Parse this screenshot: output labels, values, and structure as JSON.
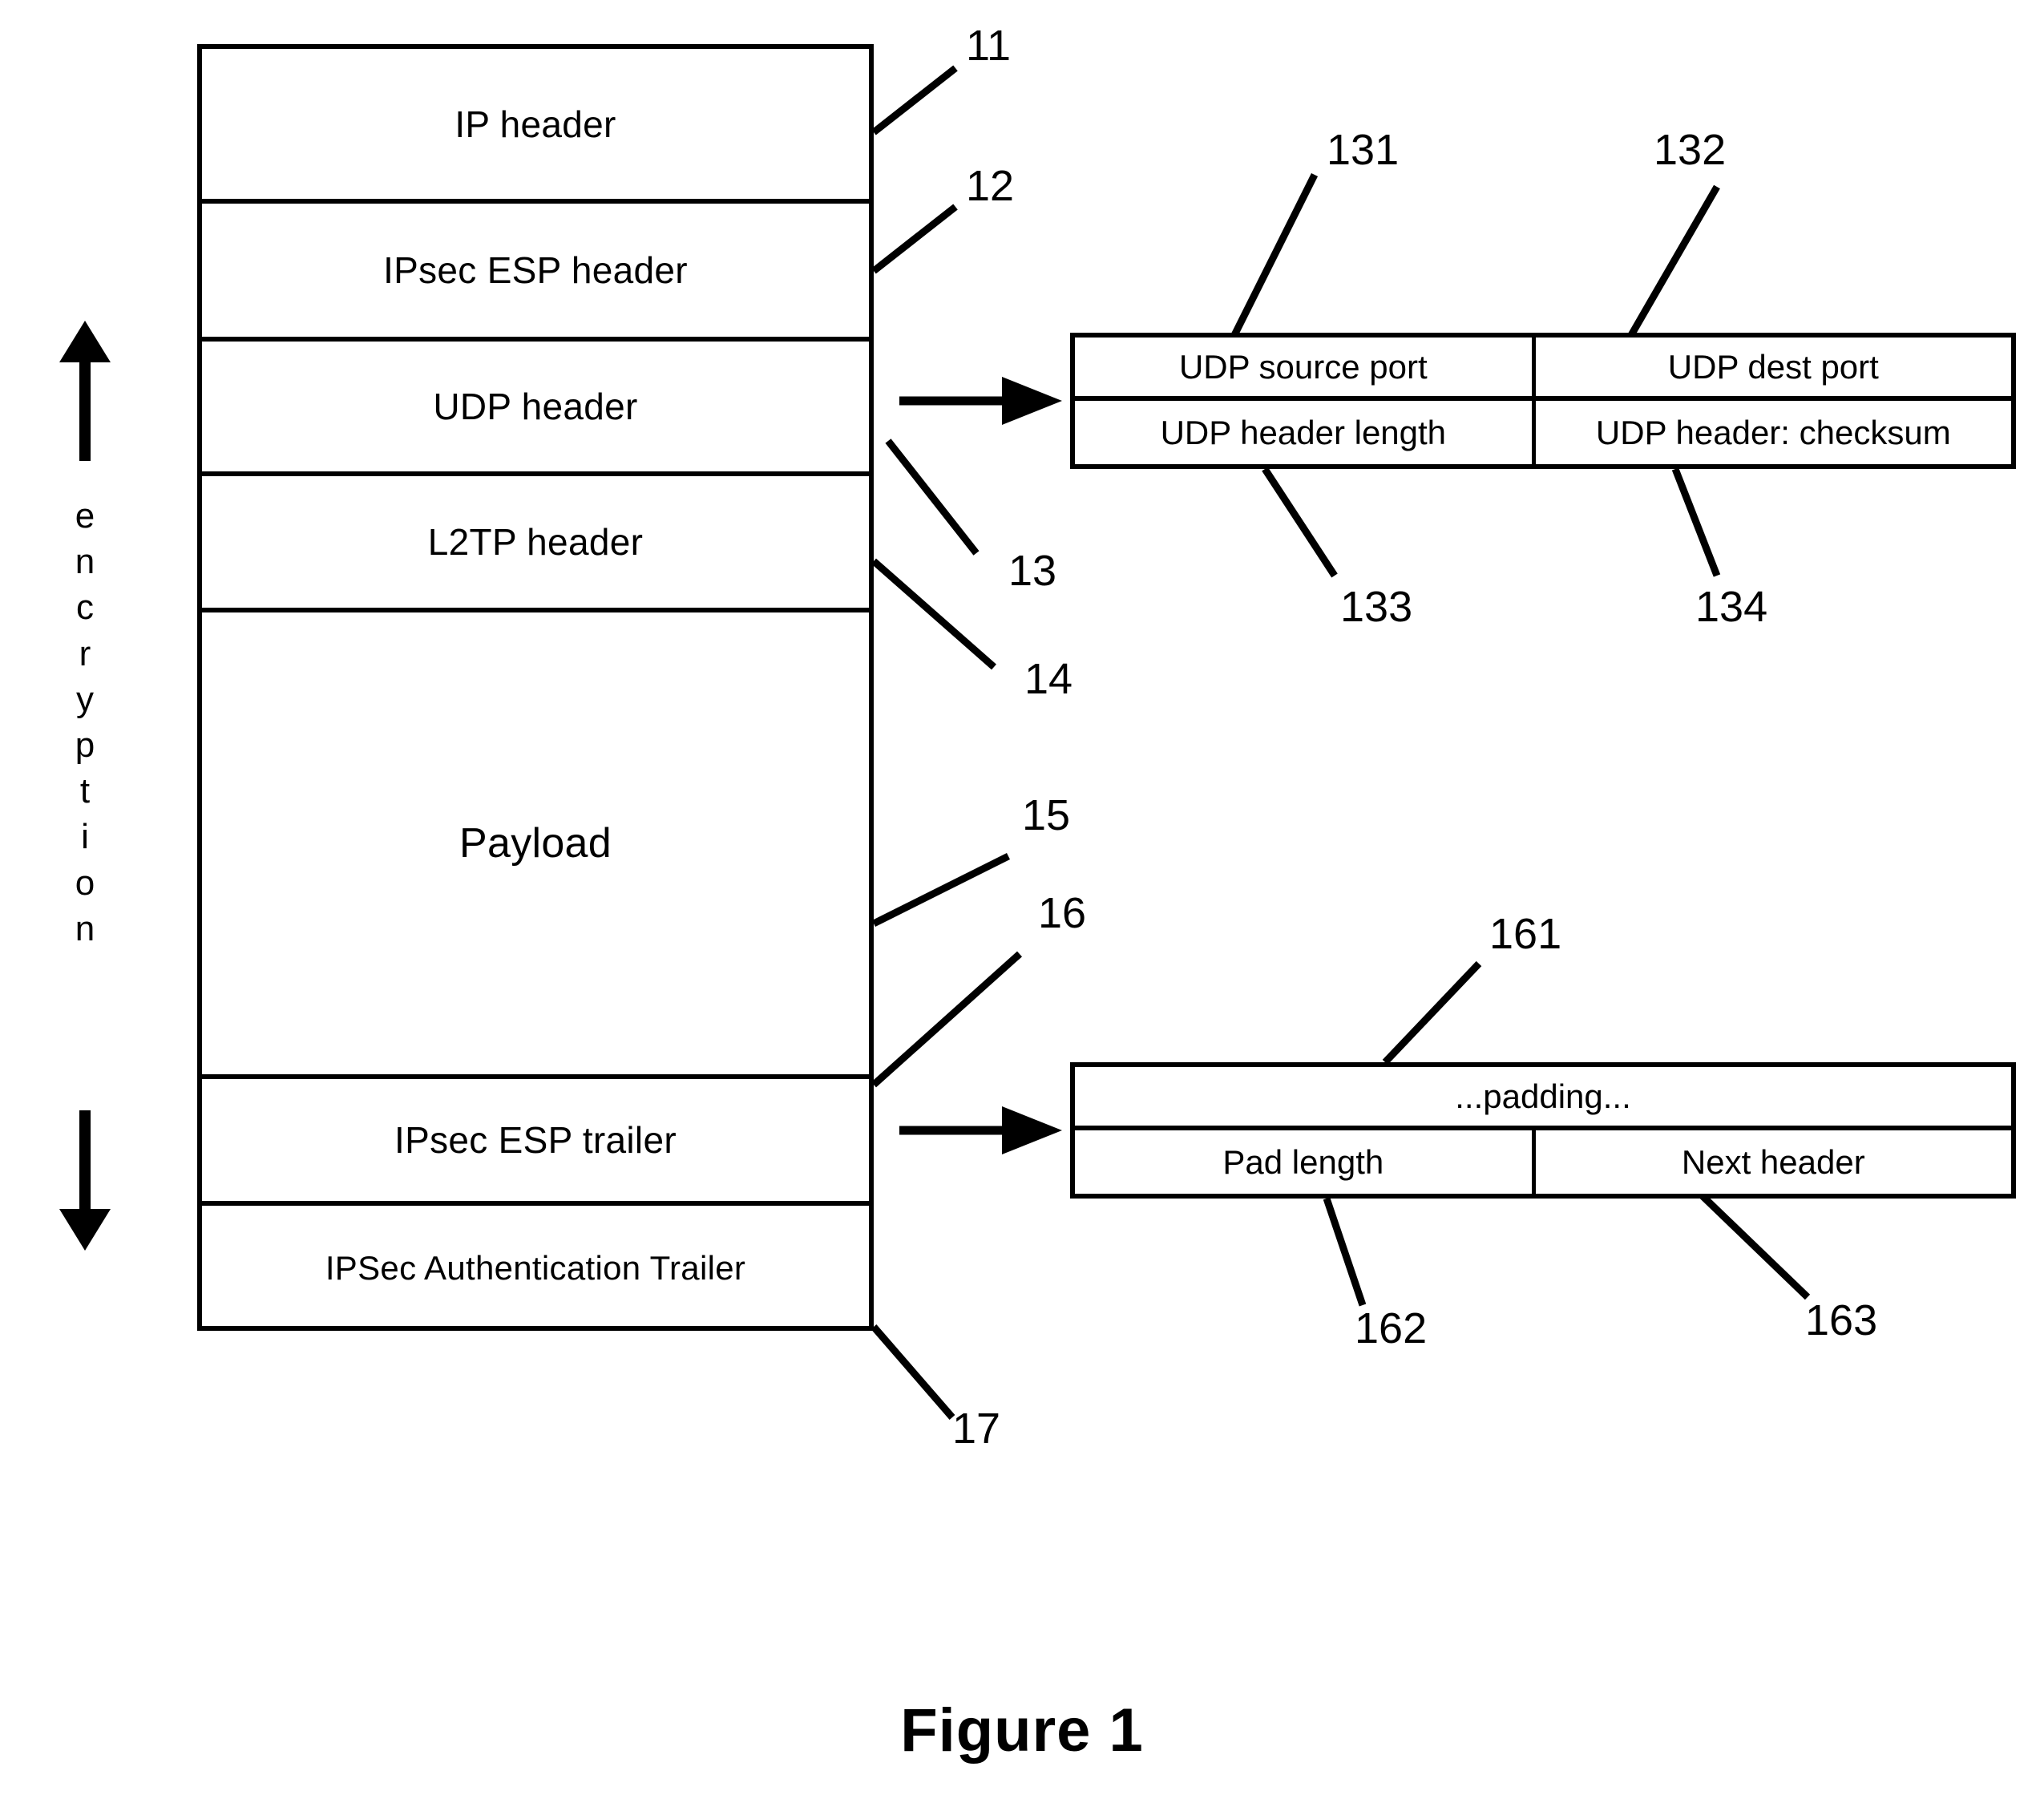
{
  "figure": {
    "caption": "Figure 1",
    "encryption_label_letters": [
      "e",
      "n",
      "c",
      "r",
      "y",
      "p",
      "t",
      "i",
      "o",
      "n"
    ],
    "encryption_label_text": "encryption"
  },
  "packet_stack": {
    "rows": [
      {
        "label": "IP header",
        "ref": "11"
      },
      {
        "label": "IPsec ESP header",
        "ref": "12"
      },
      {
        "label": "UDP header",
        "ref": "13"
      },
      {
        "label": "L2TP header",
        "ref": "14"
      },
      {
        "label": "Payload",
        "ref": "15"
      },
      {
        "label": "IPsec ESP trailer",
        "ref": "16"
      },
      {
        "label": "IPSec Authentication Trailer",
        "ref": "17"
      }
    ]
  },
  "udp_detail": {
    "cells": [
      {
        "label": "UDP source port",
        "ref": "131"
      },
      {
        "label": "UDP dest port",
        "ref": "132"
      },
      {
        "label": "UDP header length",
        "ref": "133"
      },
      {
        "label": "UDP header: checksum",
        "ref": "134"
      }
    ]
  },
  "esp_trailer_detail": {
    "cells": [
      {
        "label": "...padding...",
        "ref": "161"
      },
      {
        "label": "Pad length",
        "ref": "162"
      },
      {
        "label": "Next header",
        "ref": "163"
      }
    ]
  },
  "refs": {
    "r11": "11",
    "r12": "12",
    "r13": "13",
    "r14": "14",
    "r15": "15",
    "r16": "16",
    "r17": "17",
    "r131": "131",
    "r132": "132",
    "r133": "133",
    "r134": "134",
    "r161": "161",
    "r162": "162",
    "r163": "163"
  },
  "colors": {
    "ink": "#000000",
    "paper": "#ffffff"
  }
}
